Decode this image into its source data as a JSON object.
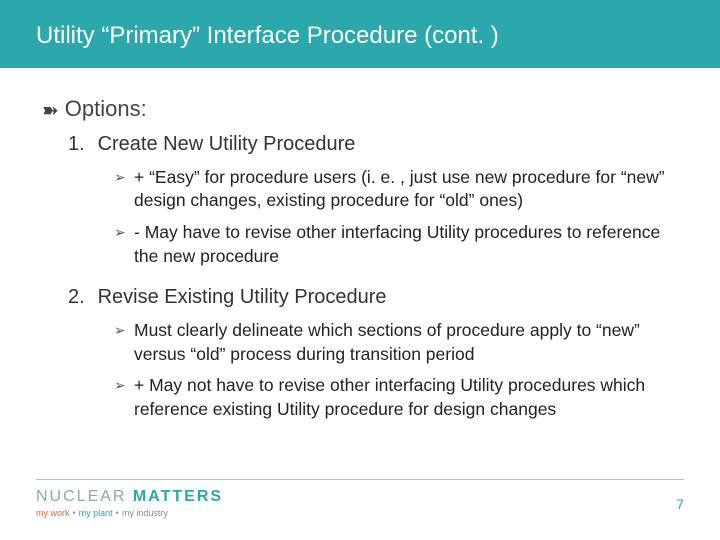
{
  "title": "Utility “Primary” Interface Procedure (cont. )",
  "options_label": "Options:",
  "items": [
    {
      "num": "1.",
      "label": "Create New Utility Procedure",
      "subs": [
        "+ “Easy” for procedure users (i. e. , just use new procedure for “new” design changes, existing procedure for “old” ones)",
        "- May have to revise other interfacing Utility procedures to reference the new procedure"
      ]
    },
    {
      "num": "2.",
      "label": "Revise Existing Utility Procedure",
      "subs": [
        "Must clearly delineate which sections of procedure apply to “new” versus “old” process during transition period",
        "+ May not have to revise other interfacing Utility procedures which reference existing Utility procedure for design changes"
      ]
    }
  ],
  "logo": {
    "line1a": "NUCLEAR",
    "line1b": "MATTERS",
    "sub_work": "my work",
    "sub_plant": "my plant",
    "sub_industry": "my industry"
  },
  "page_number": "7"
}
